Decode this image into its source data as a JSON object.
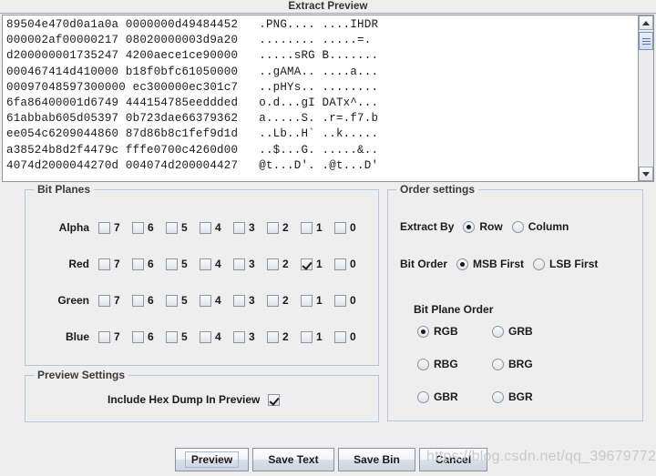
{
  "window": {
    "title": "Extract Preview"
  },
  "hex_preview": {
    "lines": [
      "89504e470d0a1a0a 0000000d49484452   .PNG.... ....IHDR",
      "000002af00000217 08020000003d9a20   ........ .....=.",
      "d200000001735247 4200aece1ce90000   .....sRG B.......",
      "000467414d410000 b18f0bfc61050000   ..gAMA.. ....a...",
      "00097048597300000 ec300000ec301c7   ..pHYs.. ........",
      "6fa86400001d6749 444154785eeddded   o.d...gI DATx^...",
      "61abbab605d05397 0b723dae66379362   a.....S. .r=.f7.b",
      "ee054c6209044860 87d86b8c1fef9d1d   ..Lb..H` ..k.....",
      "a38524b8d2f4479c fffe0700c4260d00   ..$...G. .....&..",
      "4074d2000044270d 004074d200004427   @t...D'. .@t...D'"
    ]
  },
  "scrollbar": {
    "up_arrow": "scroll-up-arrow",
    "down_arrow": "scroll-down-arrow"
  },
  "bit_planes": {
    "title": "Bit Planes",
    "bit_labels": [
      "7",
      "6",
      "5",
      "4",
      "3",
      "2",
      "1",
      "0"
    ],
    "channels": [
      {
        "label": "Alpha",
        "checked": [
          false,
          false,
          false,
          false,
          false,
          false,
          false,
          false
        ]
      },
      {
        "label": "Red",
        "checked": [
          false,
          false,
          false,
          false,
          false,
          false,
          true,
          false
        ]
      },
      {
        "label": "Green",
        "checked": [
          false,
          false,
          false,
          false,
          false,
          false,
          false,
          false
        ]
      },
      {
        "label": "Blue",
        "checked": [
          false,
          false,
          false,
          false,
          false,
          false,
          false,
          false
        ]
      }
    ]
  },
  "order_settings": {
    "title": "Order settings",
    "extract_by": {
      "label": "Extract By",
      "options": [
        "Row",
        "Column"
      ],
      "selected": "Row"
    },
    "bit_order": {
      "label": "Bit Order",
      "options": [
        "MSB First",
        "LSB First"
      ],
      "selected": "MSB First"
    },
    "bit_plane_order": {
      "label": "Bit Plane Order",
      "options": [
        "RGB",
        "GRB",
        "RBG",
        "BRG",
        "GBR",
        "BGR"
      ],
      "selected": "RGB"
    }
  },
  "preview_settings": {
    "title": "Preview Settings",
    "include_hex_dump": {
      "label": "Include Hex Dump In Preview",
      "checked": true
    }
  },
  "buttons": {
    "preview": "Preview",
    "save_text": "Save Text",
    "save_bin": "Save Bin",
    "cancel": "Cancel",
    "focused": "Preview"
  },
  "watermark": {
    "text": "https://blog.csdn.net/qq_39679772"
  }
}
